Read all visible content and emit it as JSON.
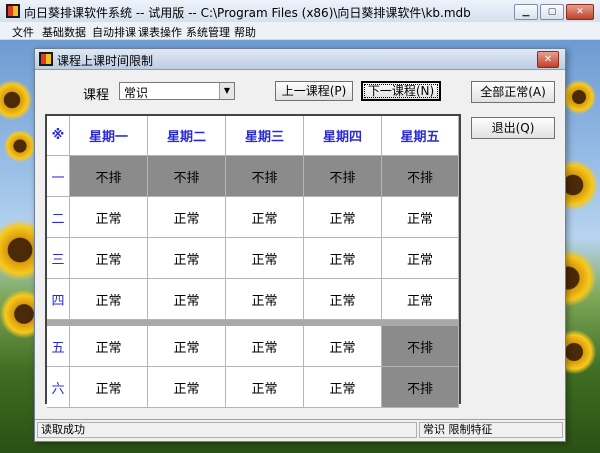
{
  "app": {
    "title": "向日葵排课软件系统 -- 试用版  -- C:\\Program Files (x86)\\向日葵排课软件\\kb.mdb",
    "menu": [
      "文件",
      "基础数据",
      "自动排课",
      "课表操作",
      "系统管理",
      "帮助"
    ]
  },
  "dialog": {
    "title": "课程上课时间限制",
    "close_glyph": "✕",
    "course_label": "课程",
    "course_value": "常识",
    "prev_button": "上一课程(P)",
    "next_button": "下一课程(N)",
    "all_normal_button": "全部正常(A)",
    "exit_button": "退出(Q)",
    "grid": {
      "corner": "※",
      "days": [
        "星期一",
        "星期二",
        "星期三",
        "星期四",
        "星期五"
      ],
      "periods": [
        "一",
        "二",
        "三",
        "四",
        "五",
        "六"
      ],
      "cells": [
        [
          "不排",
          "不排",
          "不排",
          "不排",
          "不排"
        ],
        [
          "正常",
          "正常",
          "正常",
          "正常",
          "正常"
        ],
        [
          "正常",
          "正常",
          "正常",
          "正常",
          "正常"
        ],
        [
          "正常",
          "正常",
          "正常",
          "正常",
          "正常"
        ],
        [
          "正常",
          "正常",
          "正常",
          "正常",
          "不排"
        ],
        [
          "正常",
          "正常",
          "正常",
          "正常",
          "不排"
        ]
      ]
    },
    "status": {
      "left": "读取成功",
      "right": "常识 限制特征"
    }
  },
  "colors": {
    "blocked_cell": "#8b8b8b",
    "normal_cell": "#ffffff",
    "header_text": "#2b2bd6"
  }
}
